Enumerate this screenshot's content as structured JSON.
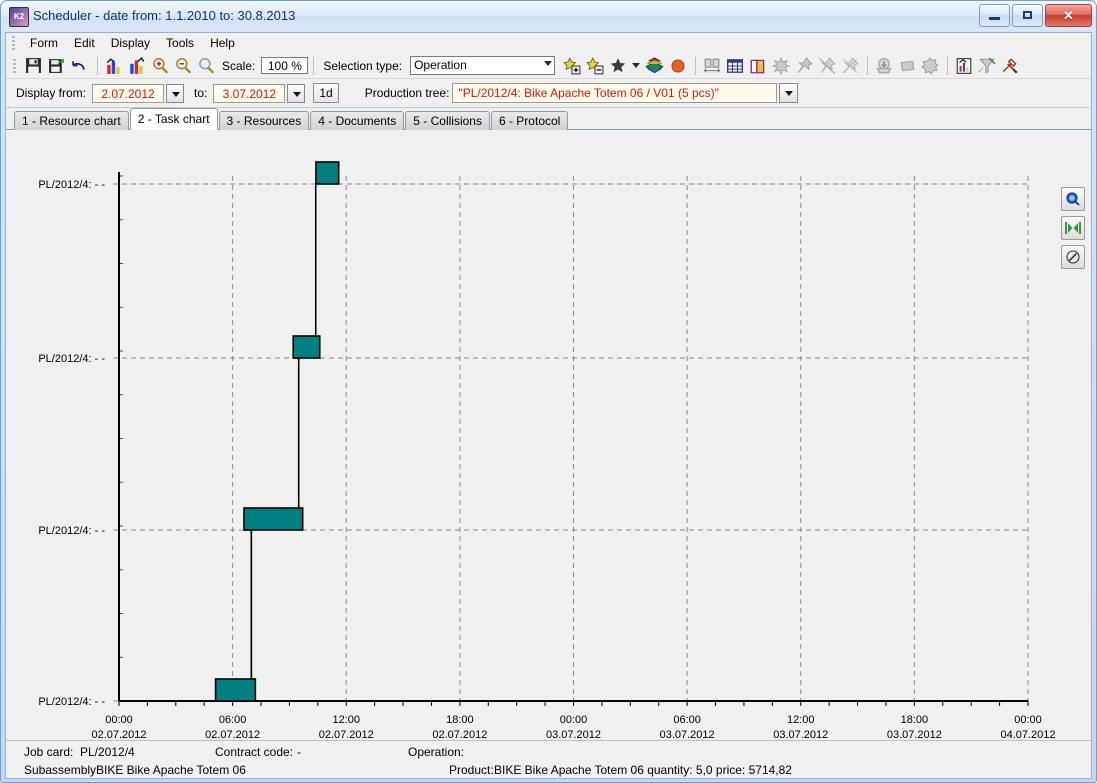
{
  "window": {
    "title": "Scheduler - date from: 1.1.2010 to: 30.8.2013",
    "app_icon": "scheduler-app-icon",
    "minimize": "minimize-icon",
    "maximize": "maximize-icon",
    "close": "✕"
  },
  "menu": {
    "items": [
      {
        "label": "Form"
      },
      {
        "label": "Edit"
      },
      {
        "label": "Display"
      },
      {
        "label": "Tools"
      },
      {
        "label": "Help"
      }
    ]
  },
  "toolbar": {
    "scale_label": "Scale:",
    "scale_value": "100 %",
    "selection_type_label": "Selection type:",
    "selection_type_value": "Operation",
    "buttons": [
      {
        "name": "save-icon"
      },
      {
        "name": "save-as-icon"
      },
      {
        "name": "undo-icon"
      },
      {
        "name": "bar-chart-icon"
      },
      {
        "name": "bar-chart-alt-icon"
      },
      {
        "name": "zoom-in-icon"
      },
      {
        "name": "zoom-out-icon"
      },
      {
        "name": "zoom-icon"
      }
    ],
    "buttons_right": [
      {
        "name": "add-operation-icon"
      },
      {
        "name": "remove-operation-icon"
      },
      {
        "name": "star-icon"
      },
      {
        "name": "star-dropdown-icon"
      },
      {
        "name": "layers-icon"
      },
      {
        "name": "stop-circle-icon"
      },
      {
        "name": "fit-width-icon"
      },
      {
        "name": "grid-icon"
      },
      {
        "name": "book-icon"
      },
      {
        "name": "burst-icon"
      },
      {
        "name": "pin-icon"
      },
      {
        "name": "unpin-icon"
      },
      {
        "name": "import-icon"
      },
      {
        "name": "shape-icon"
      },
      {
        "name": "gear-shape-icon"
      },
      {
        "name": "report-chart-icon"
      },
      {
        "name": "clear-filter-icon"
      },
      {
        "name": "tools-icon"
      }
    ]
  },
  "daterow": {
    "from_label": "Display from:",
    "from_value": "2.07.2012",
    "to_label": "to:",
    "to_value": "3.07.2012",
    "step_button": "1d",
    "tree_label": "Production tree:",
    "tree_value": "\"PL/2012/4: Bike Apache Totem 06 / V01 (5 pcs)\""
  },
  "tabs": [
    {
      "label": "1 - Resource chart",
      "active": false
    },
    {
      "label": "2 - Task chart",
      "active": true
    },
    {
      "label": "3 - Resources",
      "active": false
    },
    {
      "label": "4 - Documents",
      "active": false
    },
    {
      "label": "5 - Collisions",
      "active": false
    },
    {
      "label": "6 - Protocol",
      "active": false
    }
  ],
  "side_buttons": [
    {
      "name": "zoom-selection-icon"
    },
    {
      "name": "fit-to-window-icon"
    },
    {
      "name": "edit-pencil-icon"
    }
  ],
  "chart_data": {
    "type": "bar",
    "title": "",
    "xlabel": "",
    "ylabel": "",
    "grid": true,
    "legend": false,
    "bar_color": "#008080",
    "bar_border_color": "#000000",
    "link_color": "#000000",
    "plot_bg": "#f0f0f0",
    "y_categories": [
      "PL/2012/4: -",
      "PL/2012/4: -",
      "PL/2012/4: -",
      "PL/2012/4: -"
    ],
    "x_ticks": [
      {
        "time": "00:00",
        "date": "02.07.2012"
      },
      {
        "time": "06:00",
        "date": "02.07.2012"
      },
      {
        "time": "12:00",
        "date": "02.07.2012"
      },
      {
        "time": "18:00",
        "date": "02.07.2012"
      },
      {
        "time": "00:00",
        "date": "03.07.2012"
      },
      {
        "time": "06:00",
        "date": "03.07.2012"
      },
      {
        "time": "12:00",
        "date": "03.07.2012"
      },
      {
        "time": "18:00",
        "date": "03.07.2012"
      },
      {
        "time": "00:00",
        "date": "04.07.2012"
      }
    ],
    "x_range_hours": [
      0,
      48
    ],
    "tasks": [
      {
        "row": 0,
        "label": "PL/2012/4: -",
        "start_hours": 10.4,
        "end_hours": 11.6
      },
      {
        "row": 1,
        "label": "PL/2012/4: -",
        "start_hours": 9.2,
        "end_hours": 10.6
      },
      {
        "row": 2,
        "label": "PL/2012/4: -",
        "start_hours": 6.6,
        "end_hours": 9.7
      },
      {
        "row": 3,
        "label": "PL/2012/4: -",
        "start_hours": 5.1,
        "end_hours": 7.2
      }
    ]
  },
  "status": {
    "job_card_label": "Job card:",
    "job_card_value": "PL/2012/4",
    "contract_code_label": "Contract code:",
    "contract_code_value": "-",
    "operation_label": "Operation:",
    "operation_value": "",
    "subassembly_label": "Subassembly:",
    "subassembly_value": "BIKE  Bike Apache Totem 06",
    "product_label": "Product:",
    "product_value": "BIKE  Bike Apache Totem 06  quantity: 5,0  price: 5714,82"
  }
}
